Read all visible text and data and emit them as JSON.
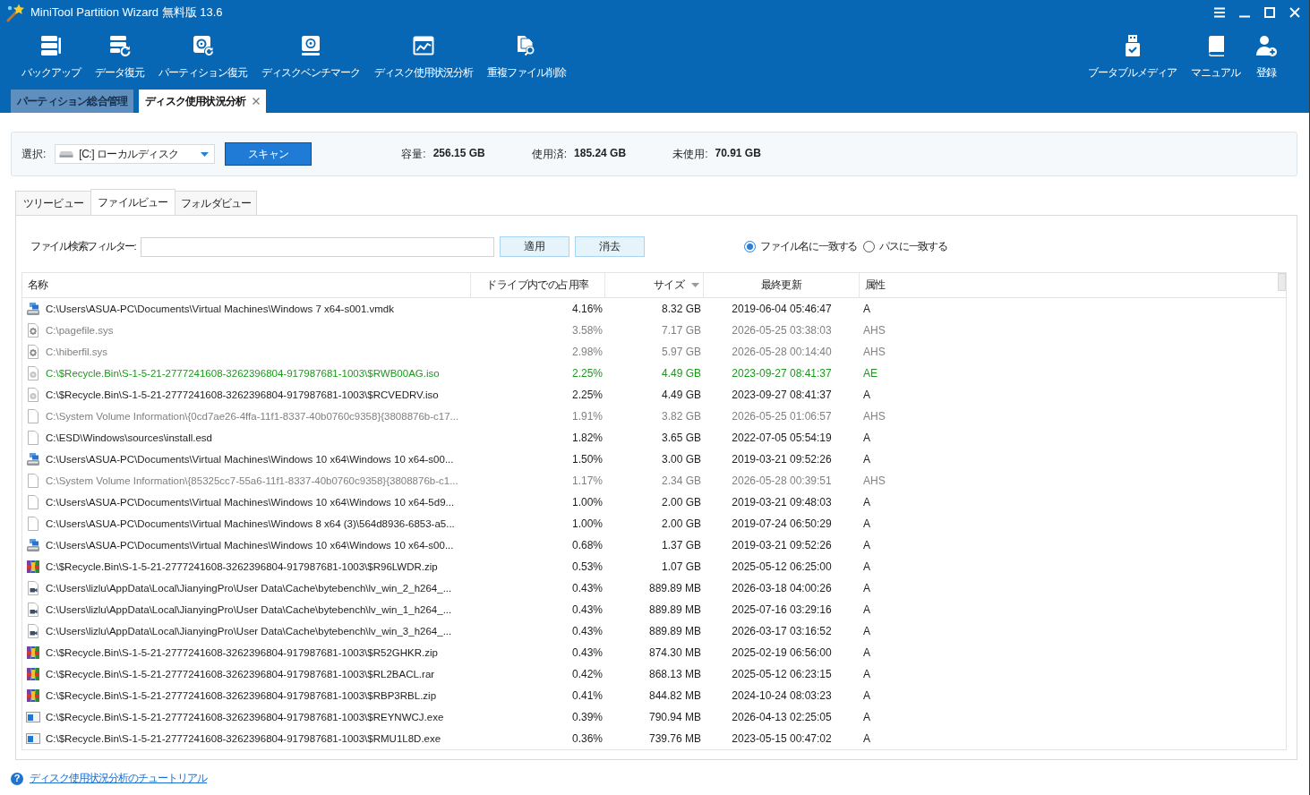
{
  "window": {
    "title": "MiniTool Partition Wizard 無料版 13.6"
  },
  "toolbar": {
    "left": [
      {
        "kind": "backup",
        "label": "バックアップ"
      },
      {
        "kind": "recovery",
        "label": "データ復元"
      },
      {
        "kind": "partition",
        "label": "パーティション復元"
      },
      {
        "kind": "benchmark",
        "label": "ディスクベンチマーク"
      },
      {
        "kind": "analyzer",
        "label": "ディスク使用状況分析"
      },
      {
        "kind": "duplicates",
        "label": "重複ファイル削除"
      }
    ],
    "right": [
      {
        "kind": "usb",
        "label": "ブータブルメディア"
      },
      {
        "kind": "manual",
        "label": "マニュアル"
      },
      {
        "kind": "register",
        "label": "登録"
      }
    ]
  },
  "tabs": [
    {
      "label": "パーティション総合管理",
      "selected": false,
      "closable": false
    },
    {
      "label": "ディスク使用状況分析",
      "selected": true,
      "closable": true
    }
  ],
  "selection": {
    "label": "選択:",
    "drive": "[C:] ローカルディスク",
    "scan_button": "スキャン",
    "stats": [
      {
        "label": "容量:",
        "value": "256.15 GB"
      },
      {
        "label": "使用済:",
        "value": "185.24 GB"
      },
      {
        "label": "未使用:",
        "value": "70.91 GB"
      }
    ]
  },
  "view_tabs": [
    {
      "label": "ツリービュー",
      "selected": false
    },
    {
      "label": "ファイルビュー",
      "selected": true
    },
    {
      "label": "フォルダビュー",
      "selected": false
    }
  ],
  "filter": {
    "label": "ファイル検索フィルター:",
    "buttons": [
      "適用",
      "消去"
    ],
    "match_options": [
      {
        "label": "ファイル名に一致する",
        "selected": true
      },
      {
        "label": "パスに一致する",
        "selected": false
      }
    ]
  },
  "table": {
    "columns": [
      {
        "label": "名称",
        "sorted": false
      },
      {
        "label": "ドライブ内での占用率",
        "sorted": false
      },
      {
        "label": "サイズ",
        "sorted": true
      },
      {
        "label": "最終更新",
        "sorted": false
      },
      {
        "label": "属性",
        "sorted": false
      }
    ],
    "rows": [
      {
        "kind": "vmdk",
        "name": "C:\\Users\\ASUA-PC\\Documents\\Virtual Machines\\Windows 7 x64-s001.vmdk",
        "share": "4.16%",
        "size": "8.32 GB",
        "modified": "2019-06-04 05:46:47",
        "attributes": "A",
        "color": "#1e1e1e"
      },
      {
        "kind": "system",
        "name": "C:\\pagefile.sys",
        "share": "3.58%",
        "size": "7.17 GB",
        "modified": "2026-05-25 03:38:03",
        "attributes": "AHS",
        "color": "#808080"
      },
      {
        "kind": "system",
        "name": "C:\\hiberfil.sys",
        "share": "2.98%",
        "size": "5.97 GB",
        "modified": "2026-05-28 00:14:40",
        "attributes": "AHS",
        "color": "#808080"
      },
      {
        "kind": "disc",
        "name": "C:\\$Recycle.Bin\\S-1-5-21-2777241608-3262396804-917987681-1003\\$RWB00AG.iso",
        "share": "2.25%",
        "size": "4.49 GB",
        "modified": "2023-09-27 08:41:37",
        "attributes": "AE",
        "color": "#1a9a1a"
      },
      {
        "kind": "disc",
        "name": "C:\\$Recycle.Bin\\S-1-5-21-2777241608-3262396804-917987681-1003\\$RCVEDRV.iso",
        "share": "2.25%",
        "size": "4.49 GB",
        "modified": "2023-09-27 08:41:37",
        "attributes": "A",
        "color": "#1e1e1e"
      },
      {
        "kind": "file",
        "name": "C:\\System Volume Information\\{0cd7ae26-4ffa-11f1-8337-40b0760c9358}{3808876b-c17...",
        "share": "1.91%",
        "size": "3.82 GB",
        "modified": "2026-05-25 01:06:57",
        "attributes": "AHS",
        "color": "#808080"
      },
      {
        "kind": "file",
        "name": "C:\\ESD\\Windows\\sources\\install.esd",
        "share": "1.82%",
        "size": "3.65 GB",
        "modified": "2022-07-05 05:54:19",
        "attributes": "A",
        "color": "#1e1e1e"
      },
      {
        "kind": "vmdk",
        "name": "C:\\Users\\ASUA-PC\\Documents\\Virtual Machines\\Windows 10 x64\\Windows 10 x64-s00...",
        "share": "1.50%",
        "size": "3.00 GB",
        "modified": "2019-03-21 09:52:26",
        "attributes": "A",
        "color": "#1e1e1e"
      },
      {
        "kind": "file",
        "name": "C:\\System Volume Information\\{85325cc7-55a6-11f1-8337-40b0760c9358}{3808876b-c1...",
        "share": "1.17%",
        "size": "2.34 GB",
        "modified": "2026-05-28 00:39:51",
        "attributes": "AHS",
        "color": "#808080"
      },
      {
        "kind": "file",
        "name": "C:\\Users\\ASUA-PC\\Documents\\Virtual Machines\\Windows 10 x64\\Windows 10 x64-5d9...",
        "share": "1.00%",
        "size": "2.00 GB",
        "modified": "2019-03-21 09:48:03",
        "attributes": "A",
        "color": "#1e1e1e"
      },
      {
        "kind": "file",
        "name": "C:\\Users\\ASUA-PC\\Documents\\Virtual Machines\\Windows 8 x64 (3)\\564d8936-6853-a5...",
        "share": "1.00%",
        "size": "2.00 GB",
        "modified": "2019-07-24 06:50:29",
        "attributes": "A",
        "color": "#1e1e1e"
      },
      {
        "kind": "vmdk",
        "name": "C:\\Users\\ASUA-PC\\Documents\\Virtual Machines\\Windows 10 x64\\Windows 10 x64-s00...",
        "share": "0.68%",
        "size": "1.37 GB",
        "modified": "2019-03-21 09:52:26",
        "attributes": "A",
        "color": "#1e1e1e"
      },
      {
        "kind": "archive",
        "name": "C:\\$Recycle.Bin\\S-1-5-21-2777241608-3262396804-917987681-1003\\$R96LWDR.zip",
        "share": "0.53%",
        "size": "1.07 GB",
        "modified": "2025-05-12 06:25:00",
        "attributes": "A",
        "color": "#1e1e1e"
      },
      {
        "kind": "video",
        "name": "C:\\Users\\lizlu\\AppData\\Local\\JianyingPro\\User Data\\Cache\\bytebench\\lv_win_2_h264_...",
        "share": "0.43%",
        "size": "889.89 MB",
        "modified": "2026-03-18 04:00:26",
        "attributes": "A",
        "color": "#1e1e1e"
      },
      {
        "kind": "video",
        "name": "C:\\Users\\lizlu\\AppData\\Local\\JianyingPro\\User Data\\Cache\\bytebench\\lv_win_1_h264_...",
        "share": "0.43%",
        "size": "889.89 MB",
        "modified": "2025-07-16 03:29:16",
        "attributes": "A",
        "color": "#1e1e1e"
      },
      {
        "kind": "video",
        "name": "C:\\Users\\lizlu\\AppData\\Local\\JianyingPro\\User Data\\Cache\\bytebench\\lv_win_3_h264_...",
        "share": "0.43%",
        "size": "889.89 MB",
        "modified": "2026-03-17 03:16:52",
        "attributes": "A",
        "color": "#1e1e1e"
      },
      {
        "kind": "archive",
        "name": "C:\\$Recycle.Bin\\S-1-5-21-2777241608-3262396804-917987681-1003\\$R52GHKR.zip",
        "share": "0.43%",
        "size": "874.30 MB",
        "modified": "2025-02-19 06:56:00",
        "attributes": "A",
        "color": "#1e1e1e"
      },
      {
        "kind": "archive",
        "name": "C:\\$Recycle.Bin\\S-1-5-21-2777241608-3262396804-917987681-1003\\$RL2BACL.rar",
        "share": "0.42%",
        "size": "868.13 MB",
        "modified": "2025-05-12 06:23:15",
        "attributes": "A",
        "color": "#1e1e1e"
      },
      {
        "kind": "archive",
        "name": "C:\\$Recycle.Bin\\S-1-5-21-2777241608-3262396804-917987681-1003\\$RBP3RBL.zip",
        "share": "0.41%",
        "size": "844.82 MB",
        "modified": "2024-10-24 08:03:23",
        "attributes": "A",
        "color": "#1e1e1e"
      },
      {
        "kind": "exe",
        "name": "C:\\$Recycle.Bin\\S-1-5-21-2777241608-3262396804-917987681-1003\\$REYNWCJ.exe",
        "share": "0.39%",
        "size": "790.94 MB",
        "modified": "2026-04-13 02:25:05",
        "attributes": "A",
        "color": "#1e1e1e"
      },
      {
        "kind": "exe",
        "name": "C:\\$Recycle.Bin\\S-1-5-21-2777241608-3262396804-917987681-1003\\$RMU1L8D.exe",
        "share": "0.36%",
        "size": "739.76 MB",
        "modified": "2023-05-15 00:47:02",
        "attributes": "A",
        "color": "#1e1e1e"
      }
    ]
  },
  "footer": {
    "help_glyph": "?",
    "tutorial_link": "ディスク使用状況分析のチュートリアル"
  }
}
